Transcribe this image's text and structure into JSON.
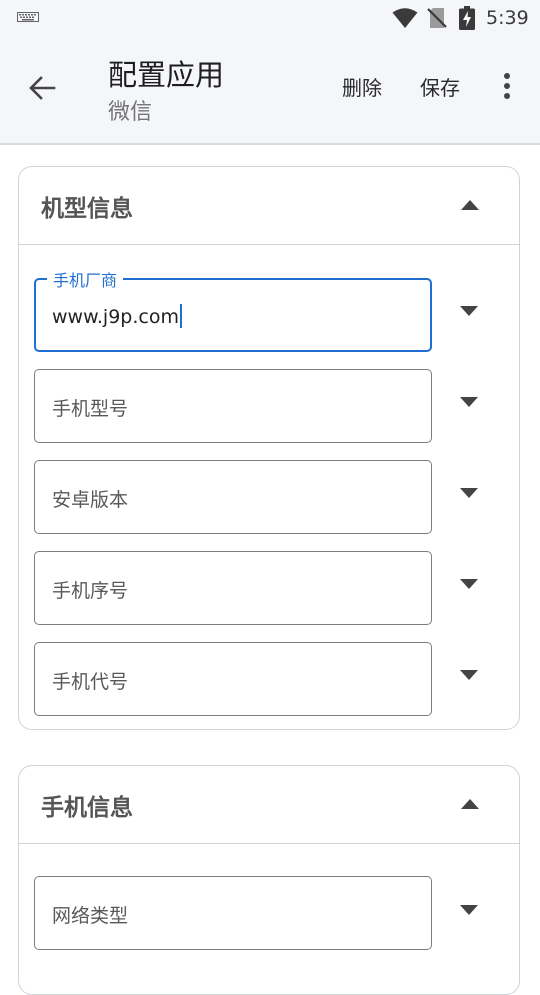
{
  "status_bar": {
    "time": "5:39",
    "icons": [
      "keyboard-icon",
      "wifi-icon",
      "no-sim-icon",
      "battery-charging-icon"
    ]
  },
  "app_bar": {
    "title": "配置应用",
    "subtitle": "微信",
    "back_icon": "arrow-left-icon",
    "delete_label": "删除",
    "save_label": "保存",
    "more_icon": "more-vert-icon"
  },
  "sections": [
    {
      "title": "机型信息",
      "expanded": true,
      "fields": [
        {
          "label": "手机厂商",
          "value": "www.j9p.com",
          "focused": true
        },
        {
          "placeholder": "手机型号"
        },
        {
          "placeholder": "安卓版本"
        },
        {
          "placeholder": "手机序号"
        },
        {
          "placeholder": "手机代号"
        }
      ]
    },
    {
      "title": "手机信息",
      "expanded": true,
      "fields": [
        {
          "placeholder": "网络类型"
        }
      ]
    }
  ],
  "colors": {
    "accent": "#1f6fd1",
    "app_bar_bg": "#f4f6fa",
    "border": "#cfd3d8"
  }
}
